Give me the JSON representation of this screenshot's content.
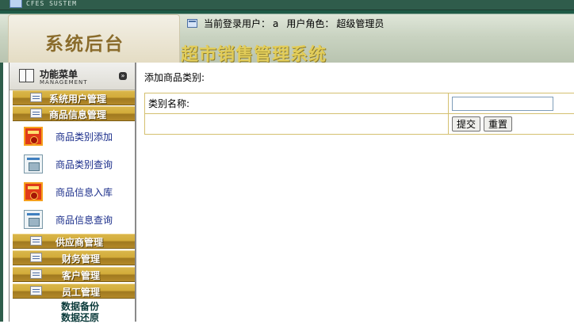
{
  "topbar": {
    "system_text": "CFES SUSTEM"
  },
  "header": {
    "logo_text": "系统后台",
    "user_label": "当前登录用户：",
    "user_name": "a",
    "role_label": "用户角色：",
    "role_name": "超级管理员",
    "app_title": "超市销售管理系统"
  },
  "sidebar": {
    "menu_title": "功能菜单",
    "menu_subtitle": "MANAGEMENT",
    "collapse_symbol": "»",
    "categories": [
      {
        "label": "系统用户管理"
      },
      {
        "label": "商品信息管理"
      },
      {
        "label": "供应商管理"
      },
      {
        "label": "财务管理"
      },
      {
        "label": "客户管理"
      },
      {
        "label": "员工管理"
      }
    ],
    "items": [
      {
        "label": "商品类别添加",
        "icon": "red-form-icon"
      },
      {
        "label": "商品类别查询",
        "icon": "blue-window-icon"
      },
      {
        "label": "商品信息入库",
        "icon": "red-form-icon"
      },
      {
        "label": "商品信息查询",
        "icon": "blue-window-icon"
      }
    ],
    "extra_links": [
      {
        "label": "数据备份"
      },
      {
        "label": "数据还原"
      }
    ]
  },
  "main": {
    "heading": "添加商品类别:",
    "form": {
      "field_label": "类别名称:",
      "field_value": "",
      "submit_label": "提交",
      "reset_label": "重置"
    }
  },
  "colors": {
    "header_green": "#1e5a46",
    "menu_gold": "#d3ac3a",
    "title_yellow": "#e2cd5a",
    "table_border": "#d4c070",
    "link_blue": "#1a2d8a"
  }
}
